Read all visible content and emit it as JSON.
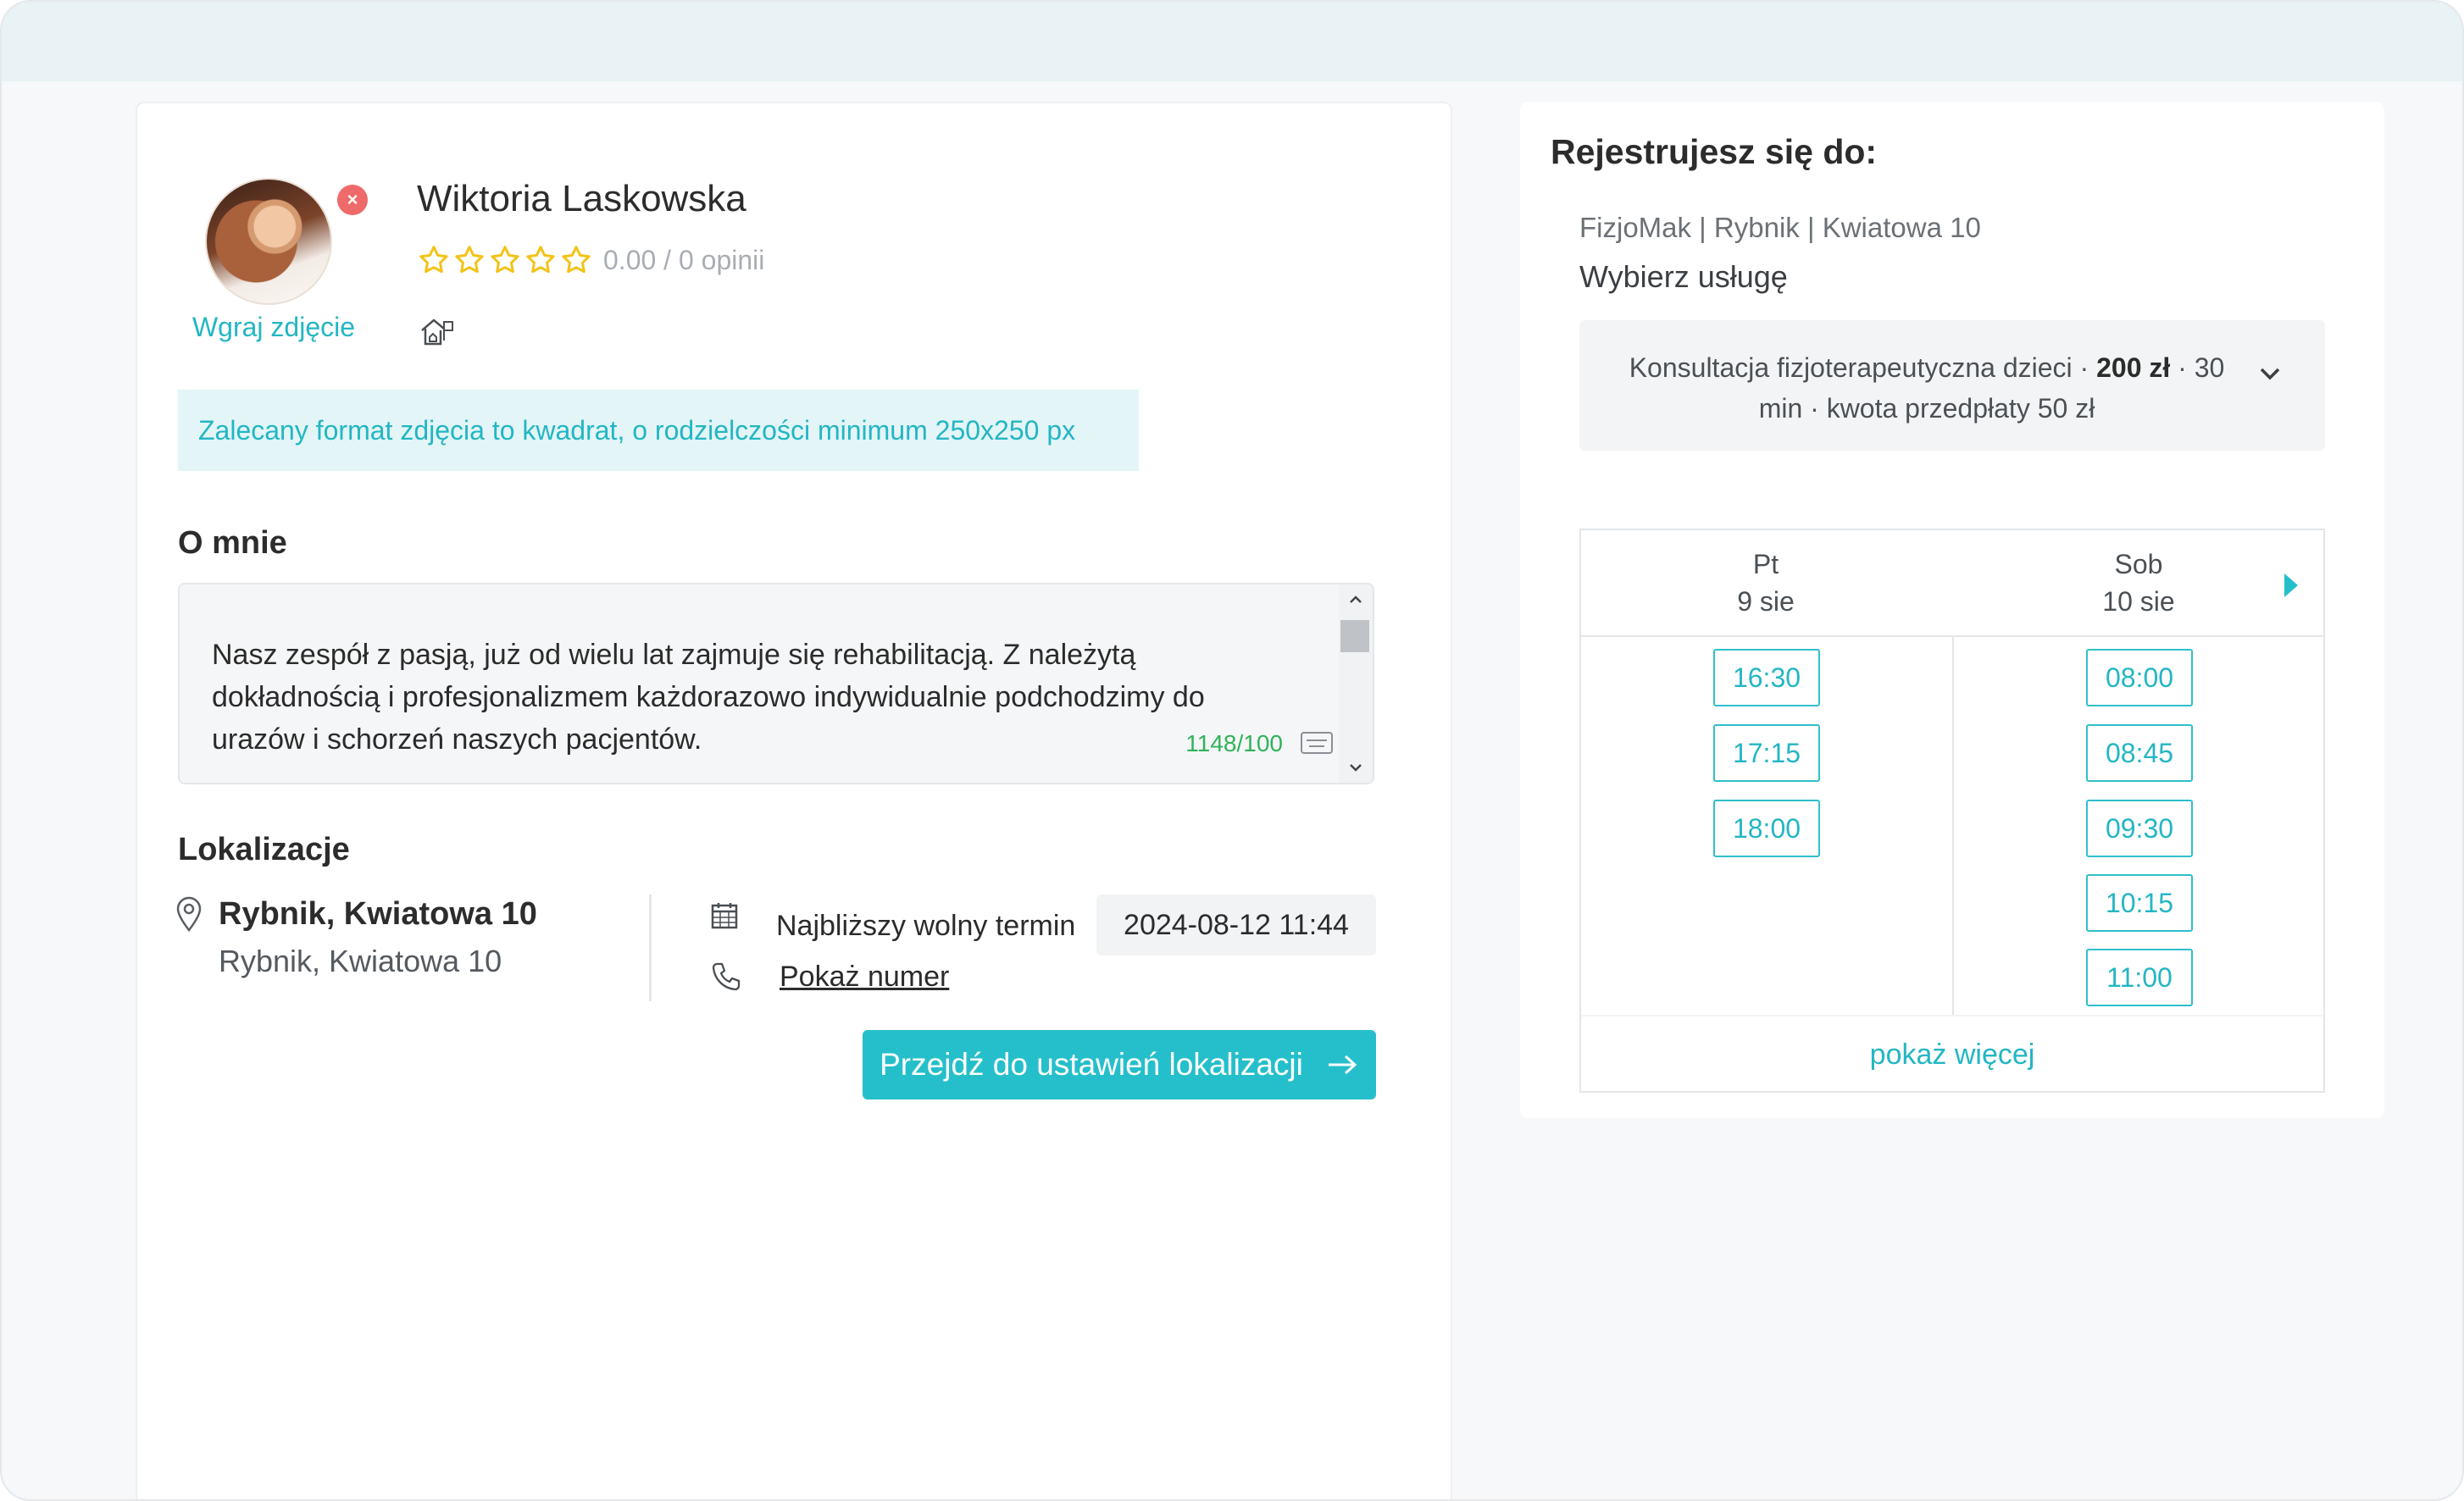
{
  "profile": {
    "upload_photo": "Wgraj zdjęcie",
    "name": "Wiktoria Laskowska",
    "rating_text": "0.00 / 0 opinii",
    "rating_value": 0,
    "rating_max": 5,
    "photo_hint": "Zalecany format zdjęcia to kwadrat, o rodzielczości minimum 250x250 px"
  },
  "about": {
    "title": "O mnie",
    "text": "Nasz zespół z pasją, już od wielu lat zajmuje się rehabilitacją. Z należytą dokładnością i profesjonalizmem każdorazowo indywidualnie podchodzimy do urazów i schorzeń naszych pacjentów.",
    "counter": "1148/100"
  },
  "locations": {
    "title": "Lokalizacje",
    "name": "Rybnik, Kwiatowa 10",
    "address": "Rybnik, Kwiatowa 10",
    "next_label": "Najbliższy wolny termin",
    "next_value": "2024-08-12 11:44",
    "show_number": "Pokaż numer",
    "settings_button": "Przejdź do ustawień lokalizacji"
  },
  "booking": {
    "title": "Rejestrujesz się do:",
    "facility_line": "FizjoMak | Rybnik | Kwiatowa 10",
    "choose_service": "Wybierz usługę",
    "service_prefix": "Konsultacja fizjoterapeutyczna dzieci · ",
    "service_price": "200 zł",
    "service_suffix": " · 30 min · kwota przedpłaty 50 zł",
    "days": [
      {
        "name": "Pt",
        "date": "9 sie",
        "slots": [
          "16:30",
          "17:15",
          "18:00"
        ]
      },
      {
        "name": "Sob",
        "date": "10 sie",
        "slots": [
          "08:00",
          "08:45",
          "09:30",
          "10:15",
          "11:00"
        ]
      }
    ],
    "show_more": "pokaż więcej"
  },
  "colors": {
    "accent": "#25bfcb",
    "accent_text": "#23b6c4",
    "star": "#f3c316",
    "remove": "#ef6a6a",
    "counter": "#2fb35a"
  },
  "icons": {
    "remove": "close-icon",
    "star": "star-outline-icon",
    "home": "home-office-icon",
    "pin": "map-pin-icon",
    "calendar": "calendar-icon",
    "phone": "phone-icon",
    "arrow": "arrow-right-icon",
    "chevron": "chevron-down-icon",
    "next": "triangle-right-icon"
  }
}
